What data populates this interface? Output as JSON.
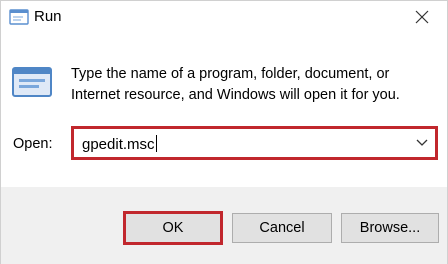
{
  "window": {
    "title": "Run"
  },
  "body": {
    "description": "Type the name of a program, folder, document, or Internet resource, and Windows will open it for you.",
    "open_label": "Open:",
    "open_value": "gpedit.msc"
  },
  "buttons": {
    "ok": "OK",
    "cancel": "Cancel",
    "browse": "Browse..."
  },
  "icons": {
    "app": "run-icon",
    "close": "close-icon",
    "dropdown": "chevron-down-icon"
  },
  "colors": {
    "highlight": "#c1272d",
    "footer_bg": "#f0f0f0",
    "button_bg": "#e1e1e1"
  }
}
